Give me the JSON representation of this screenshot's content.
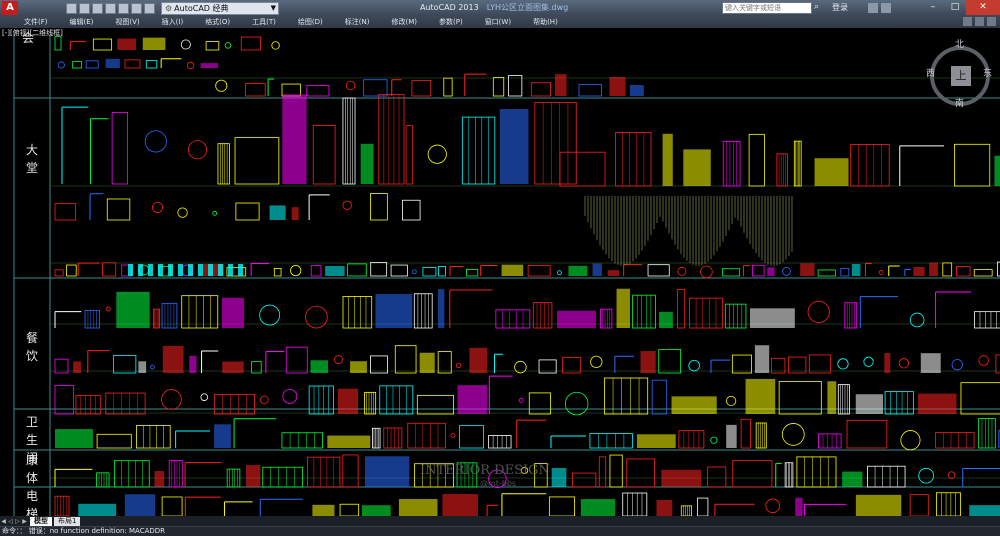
{
  "titlebar": {
    "logo": "A",
    "workspace": "AutoCAD 经典",
    "app_name": "AutoCAD 2013",
    "file_name": "LYH公区立面图集.dwg",
    "search_placeholder": "键入关键字或短语",
    "login_label": "登录"
  },
  "menu": [
    "文件(F)",
    "编辑(E)",
    "视图(V)",
    "插入(I)",
    "格式(O)",
    "工具(T)",
    "绘图(D)",
    "标注(N)",
    "修改(M)",
    "参数(P)",
    "窗口(W)",
    "帮助(H)"
  ],
  "canvas": {
    "viewport_label": "[-][俯视][二维线框]",
    "section_labels": [
      "会",
      "大\n堂",
      "餐\n饮",
      "卫\n生\n间",
      "康\n体",
      "电\n梯"
    ],
    "watermark": "INTERIOR DESIGN",
    "watermark_sub": "@mt-bbs"
  },
  "viewcube": {
    "top": "上",
    "north": "北",
    "south": "南",
    "east": "东",
    "west": "西"
  },
  "tabs": [
    "模型",
    "布局1"
  ],
  "command": "命令：：  错误：no function definition: MACADDR",
  "colors": {
    "red": "#ff2020",
    "yellow": "#ffff00",
    "green": "#00ff3c",
    "cyan": "#00ffff",
    "magenta": "#ff00ff",
    "white": "#ffffff",
    "blue": "#2a6cff",
    "gray": "#9a9a9a"
  }
}
